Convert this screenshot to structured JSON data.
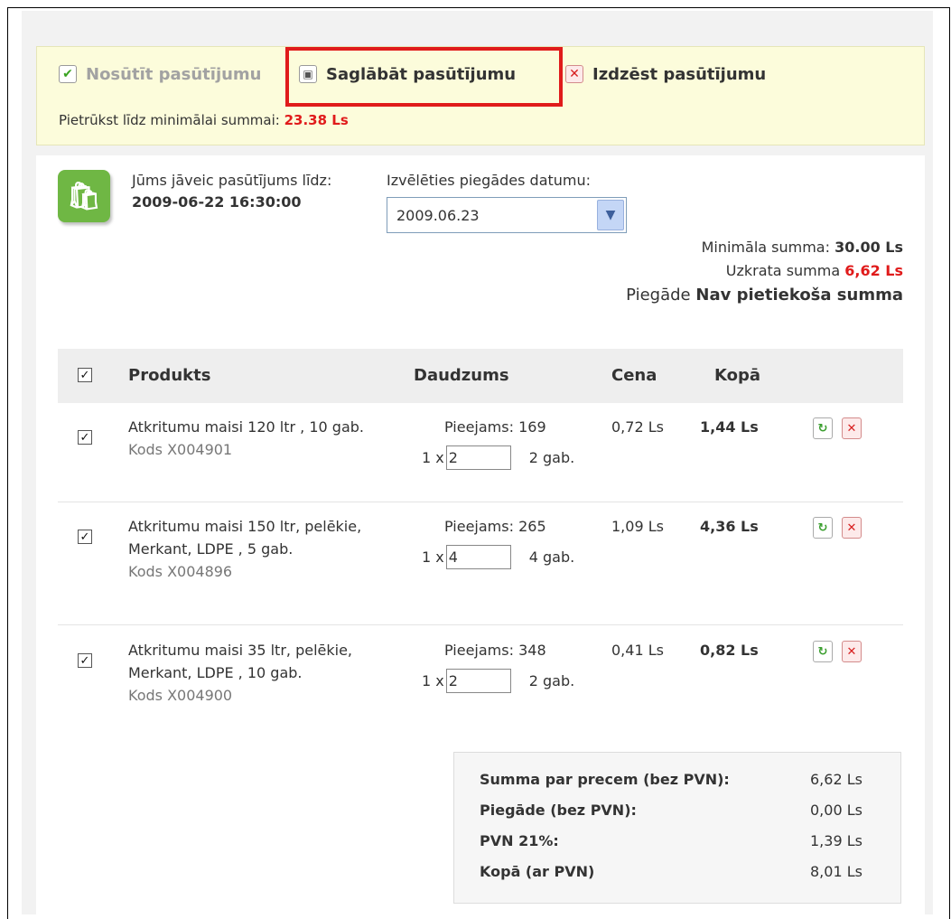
{
  "actions": {
    "send_label": "Nosūtīt pasūtījumu",
    "save_label": "Saglābāt pasūtījumu",
    "delete_label": "Izdzēst pasūtījumu"
  },
  "shortfall": {
    "label": "Pietrūkst līdz minimālai summai:",
    "value": "23.38 Ls"
  },
  "order": {
    "deadline_label": "Jūms jāveic pasūtījums līdz:",
    "deadline_value": "2009-06-22 16:30:00",
    "delivery_date_label": "Izvēlēties piegādes datumu:",
    "delivery_date_value": "2009.06.23"
  },
  "summary": {
    "min_label": "Minimāla summa:",
    "min_value": "30.00 Ls",
    "accumulated_label": "Uzkrata summa",
    "accumulated_value": "6,62 Ls",
    "delivery_label": "Piegāde",
    "delivery_value": "Nav pietiekoša summa"
  },
  "table": {
    "headers": {
      "product": "Produkts",
      "quantity": "Daudzums",
      "price": "Cena",
      "total": "Kopā"
    },
    "rows": [
      {
        "name": "Atkritumu maisi 120 ltr , 10 gab.",
        "code": "Kods X004901",
        "available": "Pieejams: 169",
        "qty_prefix": "1 x",
        "qty_value": "2",
        "qty_suffix": "2 gab.",
        "price": "0,72  Ls",
        "total": "1,44 Ls"
      },
      {
        "name": "Atkritumu maisi 150 ltr, pelēkie, Merkant, LDPE , 5 gab.",
        "code": "Kods X004896",
        "available": "Pieejams: 265",
        "qty_prefix": "1 x",
        "qty_value": "4",
        "qty_suffix": "4 gab.",
        "price": "1,09  Ls",
        "total": "4,36 Ls"
      },
      {
        "name": "Atkritumu maisi 35 ltr, pelēkie, Merkant, LDPE , 10 gab.",
        "code": "Kods X004900",
        "available": "Pieejams: 348",
        "qty_prefix": "1 x",
        "qty_value": "2",
        "qty_suffix": "2 gab.",
        "price": "0,41  Ls",
        "total": "0,82 Ls"
      }
    ]
  },
  "totals": [
    {
      "label": "Summa par precem (bez PVN):",
      "value": "6,62 Ls"
    },
    {
      "label": "Piegāde (bez PVN):",
      "value": "0,00 Ls"
    },
    {
      "label": "PVN 21%:",
      "value": "1,39 Ls"
    },
    {
      "label": "Kopā (ar PVN)",
      "value": "8,01 Ls"
    }
  ],
  "colors": {
    "accent_red": "#e01b1b",
    "bar_yellow": "#fcfcdb",
    "icon_green": "#6fb744"
  },
  "icons": [
    "check-icon",
    "save-disk-icon",
    "delete-x-icon",
    "shopping-bag-icon",
    "chevron-down-icon",
    "refresh-icon"
  ]
}
